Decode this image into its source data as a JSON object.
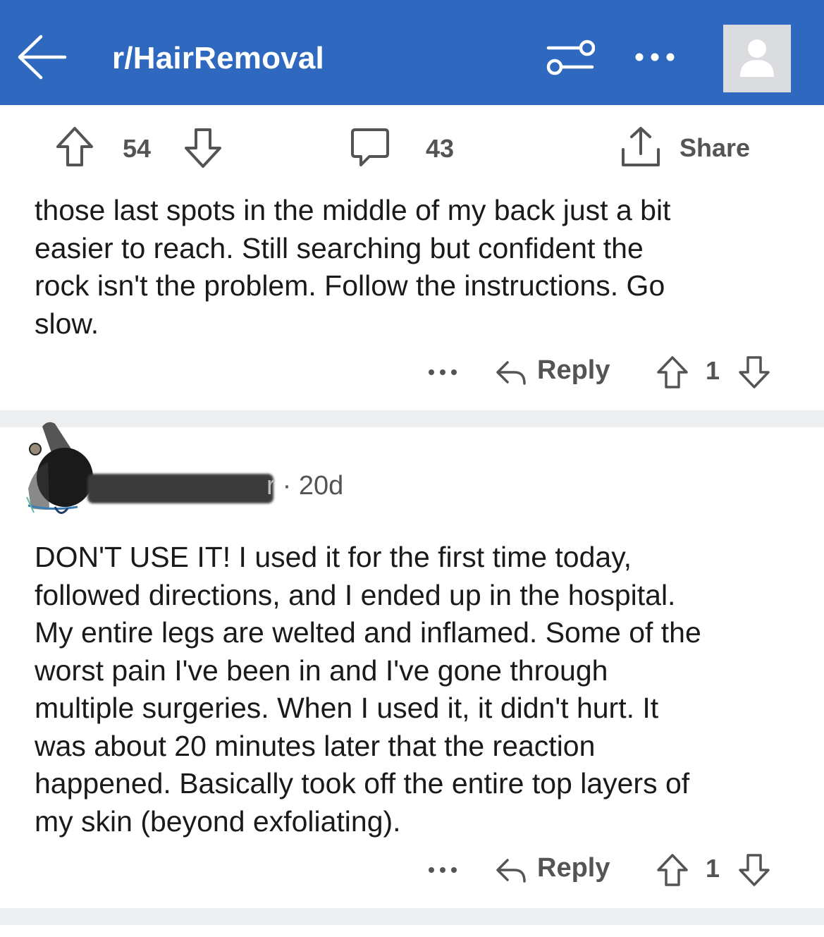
{
  "header": {
    "subreddit": "r/HairRemoval",
    "back_icon": "arrow-left-icon",
    "filter_icon": "sliders-icon",
    "more_icon": "ellipsis-icon",
    "avatar_icon": "user-icon",
    "bg_color": "#2e69bf"
  },
  "post_actions": {
    "upvotes": "54",
    "comments": "43",
    "share_label": "Share"
  },
  "comments": [
    {
      "text": "those last spots in the middle of my back just a bit\neasier to reach. Still searching but confident the\nrock isn't the problem. Follow the instructions. Go\nslow.",
      "reply_label": "Reply",
      "score": "1"
    },
    {
      "author_fragment": "r",
      "meta": "· 20d",
      "text": "DON'T USE IT! I used it for the first time today,\nfollowed directions, and I ended up in the hospital.\nMy entire legs are welted and inflamed. Some of the\nworst pain I've been in and I've gone through\nmultiple surgeries. When I used it, it didn't hurt. It\nwas about 20 minutes later that the reaction\nhappened. Basically took off the entire top layers of\nmy skin (beyond exfoliating).",
      "reply_label": "Reply",
      "score": "1"
    }
  ]
}
